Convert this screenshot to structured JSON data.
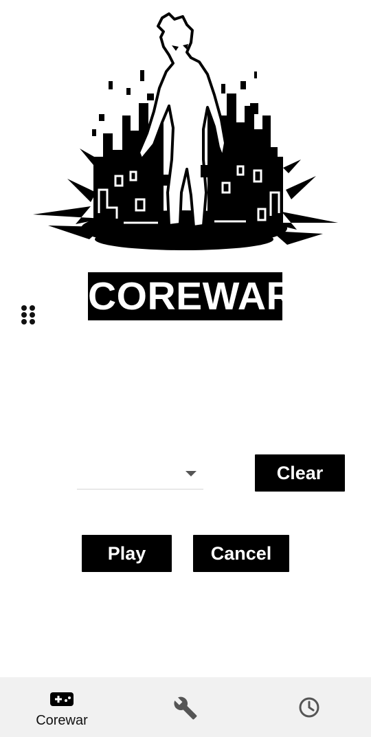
{
  "app": {
    "title": "COREWAR"
  },
  "hero": {
    "icon": "corewar-hero-illustration"
  },
  "controls": {
    "dropdown_value": "",
    "clear_label": "Clear",
    "play_label": "Play",
    "cancel_label": "Cancel"
  },
  "bottom_nav": {
    "items": [
      {
        "id": "corewar",
        "label": "Corewar",
        "icon": "gamepad-icon",
        "active": true
      },
      {
        "id": "tools",
        "label": "",
        "icon": "wrench-icon",
        "active": false
      },
      {
        "id": "history",
        "label": "",
        "icon": "clock-icon",
        "active": false
      }
    ]
  },
  "colors": {
    "background": "#ffffff",
    "primary": "#000000",
    "on_primary": "#ffffff",
    "nav_background": "#f1f1f1",
    "inactive_icon": "#555555"
  }
}
